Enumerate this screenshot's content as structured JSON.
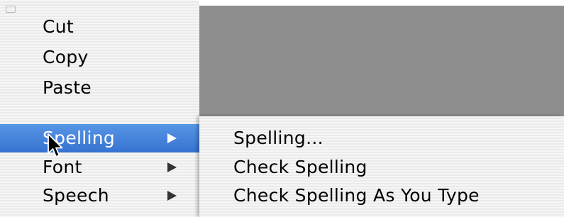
{
  "context_menu": {
    "items": [
      {
        "label": "Cut"
      },
      {
        "label": "Copy"
      },
      {
        "label": "Paste"
      },
      {
        "label": "Spelling"
      },
      {
        "label": "Font"
      },
      {
        "label": "Speech"
      }
    ]
  },
  "spelling_submenu": {
    "items": [
      {
        "label": "Spelling..."
      },
      {
        "label": "Check Spelling"
      },
      {
        "label": "Check Spelling As You Type"
      }
    ]
  },
  "colors": {
    "highlight": "#3c7ed8",
    "menu_background": "#f4f4f4",
    "backdrop": "#8e8e8e"
  },
  "icons": {
    "submenu_arrow": "right-triangle",
    "cursor": "arrow-pointer"
  }
}
